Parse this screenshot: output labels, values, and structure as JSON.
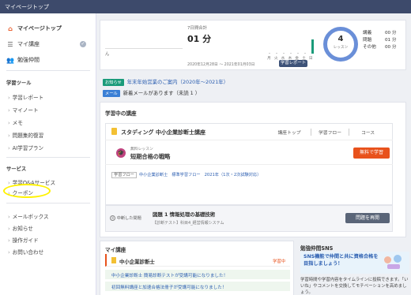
{
  "topbar": {
    "title": "マイページトップ"
  },
  "sidebar": {
    "items": [
      {
        "label": "マイページトップ",
        "icon": "home-icon"
      },
      {
        "label": "マイ講座",
        "icon": "course-list-icon"
      },
      {
        "label": "勉強仲間",
        "icon": "people-icon"
      }
    ],
    "study_tools_title": "学習ツール",
    "study_tools": [
      {
        "label": "学習レポート"
      },
      {
        "label": "マイノート"
      },
      {
        "label": "メモ"
      },
      {
        "label": "問題集的復習"
      },
      {
        "label": "AI学習プラン"
      }
    ],
    "services_title": "サービス",
    "services": [
      {
        "label": "学習Q&Aサービス"
      },
      {
        "label": "クーポン"
      }
    ],
    "misc": [
      {
        "label": "メールボックス"
      },
      {
        "label": "お知らせ"
      },
      {
        "label": "操作ガイド"
      },
      {
        "label": "お問い合わせ"
      }
    ]
  },
  "summary": {
    "user_suffix": "ん",
    "week_label": "7日間合計",
    "week_value": "01 分",
    "date_range": "2020年12月28日 ～ 2021年01月03日",
    "days": [
      "月",
      "火",
      "水",
      "木",
      "金",
      "土",
      "日"
    ],
    "report_button": "学習レポート",
    "lesson_count": "4",
    "lesson_unit": "レッスン",
    "stats": [
      {
        "label": "講義",
        "value": "00 分"
      },
      {
        "label": "問題",
        "value": "01 分"
      },
      {
        "label": "その他",
        "value": "00 分"
      }
    ]
  },
  "notices": [
    {
      "tag": "お知らせ",
      "text": "年末年始営業のご案内（2020年～2021年）",
      "tag_color": "#1a9b7a"
    },
    {
      "tag": "メール",
      "text": "新着メールがあります（未読 1 ）",
      "tag_color": "#3a7fd5"
    }
  ],
  "in_progress": {
    "section_title": "学習中の講座",
    "course_name": "スタディング 中小企業診断士講座",
    "links": [
      "講座トップ",
      "学習フロー",
      "コース"
    ],
    "free_label": "無料レッスン",
    "lesson_title": "短期合格の戦略",
    "free_button": "無料で学習",
    "breadcrumb": [
      "学習フロー",
      "中小企業診断士",
      "標準学習フロー",
      "2021年（1次・2次試験対応）"
    ],
    "in_progress_label": "中断した問題",
    "question_title": "図題 1 情報処理の基礎技術",
    "question_sub": "【診断テスト】科目4_経営情報システム",
    "resume_button": "問題を再開"
  },
  "my_courses": {
    "section_title": "マイ講座",
    "course_name": "中小企業診断士",
    "status": "学習中",
    "rows": [
      "中小企業診断士 簡易診断テストが受講可能になりました！",
      "初回無料講座と加速合格法冊子が受講可能になりました！"
    ]
  },
  "sns": {
    "section_title": "勉強仲間SNS",
    "headline": "SNS機能で仲間と共に資格合格を目指しましょう！",
    "body": "学習時間や学習内容をタイムラインに投稿できます。「いいね」やコメントを交換してモチベーションを高めましょう。"
  },
  "colors": {
    "topbar": "#3d4a6b",
    "accent_orange": "#e8521c",
    "ring": "#6a8fd8",
    "highlight": "#fff200"
  }
}
